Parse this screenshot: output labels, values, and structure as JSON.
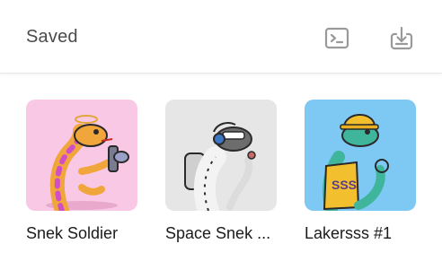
{
  "header": {
    "title": "Saved",
    "actions": [
      {
        "icon": "terminal-icon"
      },
      {
        "icon": "download-icon"
      }
    ]
  },
  "collection": {
    "items": [
      {
        "name": "Snek Soldier",
        "background": "#f9c8e4",
        "image": "snake-soldier-art"
      },
      {
        "name": "Space Snek ...",
        "background": "#e6e6e6",
        "image": "snake-astronaut-art"
      },
      {
        "name": "Lakersss #1",
        "background": "#7ec8f4",
        "image": "snake-lakers-art"
      }
    ]
  },
  "colors": {
    "icon_gray": "#9a9a9a",
    "divider": "#e8e8e8"
  }
}
